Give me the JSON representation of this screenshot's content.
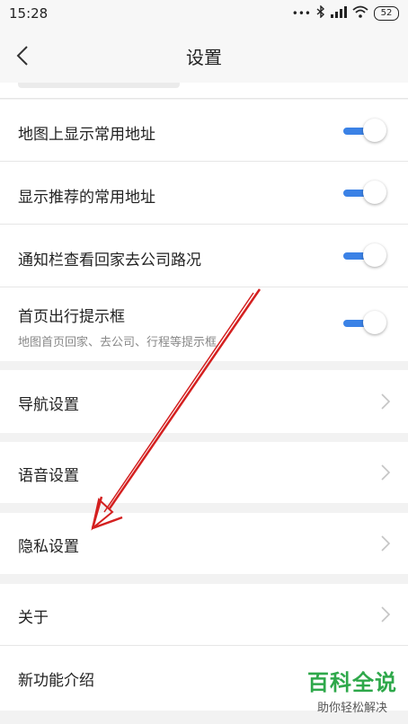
{
  "status_bar": {
    "time": "15:28",
    "battery": "52"
  },
  "header": {
    "title": "设置"
  },
  "toggles": [
    {
      "label": "地图上显示常用地址",
      "on": true
    },
    {
      "label": "显示推荐的常用地址",
      "on": true
    },
    {
      "label": "通知栏查看回家去公司路况",
      "on": true
    },
    {
      "label": "首页出行提示框",
      "sublabel": "地图首页回家、去公司、行程等提示框",
      "on": true
    }
  ],
  "menu": [
    {
      "label": "导航设置"
    },
    {
      "label": "语音设置"
    },
    {
      "label": "隐私设置"
    },
    {
      "label": "关于"
    },
    {
      "label": "新功能介绍"
    }
  ],
  "colors": {
    "accent": "#3b82e6",
    "annotation_arrow": "#d42020",
    "watermark": "#2ea84a"
  },
  "watermark": {
    "main": "百科全说",
    "sub": "助你轻松解决"
  }
}
